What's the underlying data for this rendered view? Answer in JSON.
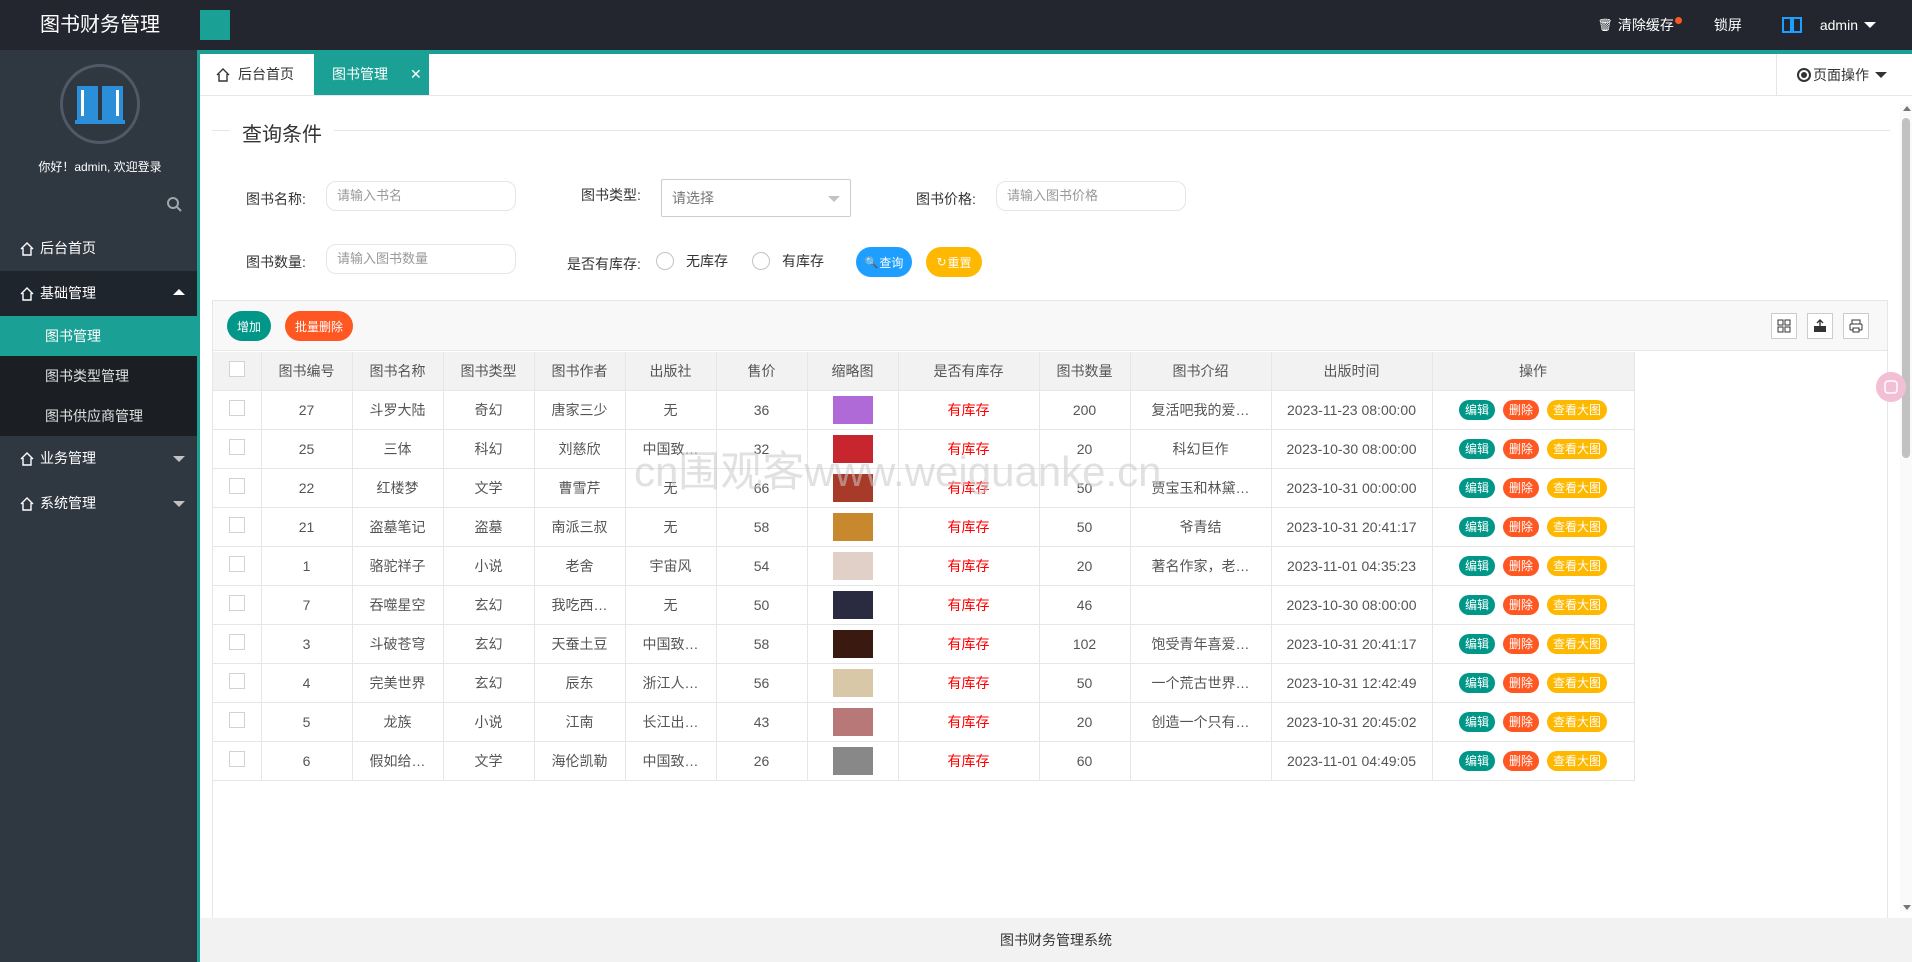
{
  "app": {
    "title": "图书财务管理",
    "footer": "图书财务管理系统"
  },
  "top": {
    "clear_cache": "清除缓存",
    "lock": "锁屏",
    "user": "admin"
  },
  "sidebar": {
    "welcome": "你好！admin, 欢迎登录",
    "items": [
      {
        "label": "后台首页"
      },
      {
        "label": "基础管理"
      },
      {
        "label": "业务管理"
      },
      {
        "label": "系统管理"
      }
    ],
    "sub_items": [
      {
        "label": "图书管理"
      },
      {
        "label": "图书类型管理"
      },
      {
        "label": "图书供应商管理"
      }
    ]
  },
  "tabs": {
    "home": "后台首页",
    "books": "图书管理",
    "page_ops": "页面操作"
  },
  "query": {
    "legend": "查询条件",
    "name_label": "图书名称:",
    "name_placeholder": "请输入书名",
    "type_label": "图书类型:",
    "type_value": "请选择",
    "price_label": "图书价格:",
    "price_placeholder": "请输入图书价格",
    "qty_label": "图书数量:",
    "qty_placeholder": "请输入图书数量",
    "stock_label": "是否有库存:",
    "opt_none": "无库存",
    "opt_have": "有库存",
    "search_btn": "查询",
    "reset_btn": "重置"
  },
  "toolbar": {
    "add": "增加",
    "batch_delete": "批量删除"
  },
  "table": {
    "headers": [
      "图书编号",
      "图书名称",
      "图书类型",
      "图书作者",
      "出版社",
      "售价",
      "缩略图",
      "是否有库存",
      "图书数量",
      "图书介绍",
      "出版时间",
      "操作"
    ],
    "ops": {
      "edit": "编辑",
      "del": "删除",
      "view": "查看大图"
    },
    "rows": [
      {
        "id": "27",
        "name": "斗罗大陆",
        "type": "奇幻",
        "author": "唐家三少",
        "press": "无",
        "price": "36",
        "stock": "有库存",
        "qty": "200",
        "intro": "复活吧我的爱…",
        "date": "2023-11-23 08:00:00",
        "color": "#b06ad8"
      },
      {
        "id": "25",
        "name": "三体",
        "type": "科幻",
        "author": "刘慈欣",
        "press": "中国致…",
        "price": "32",
        "stock": "有库存",
        "qty": "20",
        "intro": "科幻巨作",
        "date": "2023-10-30 08:00:00",
        "color": "#c8262e"
      },
      {
        "id": "22",
        "name": "红楼梦",
        "type": "文学",
        "author": "曹雪芹",
        "press": "无",
        "price": "66",
        "stock": "有库存",
        "qty": "50",
        "intro": "贾宝玉和林黛…",
        "date": "2023-10-31 00:00:00",
        "color": "#a83a2a"
      },
      {
        "id": "21",
        "name": "盗墓笔记",
        "type": "盗墓",
        "author": "南派三叔",
        "press": "无",
        "price": "58",
        "stock": "有库存",
        "qty": "50",
        "intro": "爷青结",
        "date": "2023-10-31 20:41:17",
        "color": "#c8882e"
      },
      {
        "id": "1",
        "name": "骆驼祥子",
        "type": "小说",
        "author": "老舍",
        "press": "宇宙风",
        "price": "54",
        "stock": "有库存",
        "qty": "20",
        "intro": "著名作家，老…",
        "date": "2023-11-01 04:35:23",
        "color": "#e0d0c8"
      },
      {
        "id": "7",
        "name": "吞噬星空",
        "type": "玄幻",
        "author": "我吃西…",
        "press": "无",
        "price": "50",
        "stock": "有库存",
        "qty": "46",
        "intro": "",
        "date": "2023-10-30 08:00:00",
        "color": "#2a2a40"
      },
      {
        "id": "3",
        "name": "斗破苍穹",
        "type": "玄幻",
        "author": "天蚕土豆",
        "press": "中国致…",
        "price": "58",
        "stock": "有库存",
        "qty": "102",
        "intro": "饱受青年喜爱…",
        "date": "2023-10-31 20:41:17",
        "color": "#3a1a10"
      },
      {
        "id": "4",
        "name": "完美世界",
        "type": "玄幻",
        "author": "辰东",
        "press": "浙江人…",
        "price": "56",
        "stock": "有库存",
        "qty": "50",
        "intro": "一个荒古世界…",
        "date": "2023-10-31 12:42:49",
        "color": "#d8c8a8"
      },
      {
        "id": "5",
        "name": "龙族",
        "type": "小说",
        "author": "江南",
        "press": "长江出…",
        "price": "43",
        "stock": "有库存",
        "qty": "20",
        "intro": "创造一个只有…",
        "date": "2023-10-31 20:45:02",
        "color": "#b87878"
      },
      {
        "id": "6",
        "name": "假如给…",
        "type": "文学",
        "author": "海伦凯勒",
        "press": "中国致…",
        "price": "26",
        "stock": "有库存",
        "qty": "60",
        "intro": "",
        "date": "2023-11-01 04:49:05",
        "color": "#888888"
      }
    ]
  },
  "watermark": "cn围观客www.weiguanke.cn",
  "colors": {
    "brand": "#1aa094",
    "header": "#23262e",
    "sidebar": "#2f3740",
    "danger": "#ff5722",
    "warn": "#ffb800",
    "primary": "#1e9fff"
  }
}
